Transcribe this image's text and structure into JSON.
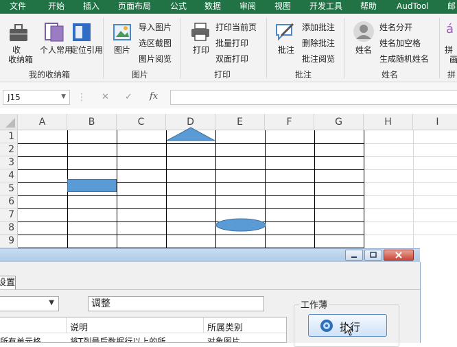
{
  "ribbon_tabs": [
    "文件",
    "开始",
    "插入",
    "页面布局",
    "公式",
    "数据",
    "审阅",
    "视图",
    "开发工具",
    "帮助",
    "AudTool",
    "邮"
  ],
  "groups": {
    "my_storage": {
      "label": "我的收纳箱",
      "storage_box": "收纳箱",
      "personal": "个人常用",
      "locate": "定位引用"
    },
    "picture": {
      "label": "图片",
      "picture": "图片",
      "import": "导入图片",
      "region_capture": "选区截图",
      "browse": "图片阅览"
    },
    "print": {
      "label": "打印",
      "print": "打印",
      "print_page": "打印当前页",
      "batch_print": "批量打印",
      "duplex_print": "双面打印"
    },
    "annotation": {
      "label": "批注",
      "annotate": "批注",
      "add": "添加批注",
      "delete": "删除批注",
      "browse": "批注阅览"
    },
    "name": {
      "label": "姓名",
      "name": "姓名",
      "split": "姓名分开",
      "add_space": "姓名加空格",
      "random": "生成随机姓名"
    },
    "pinyin": {
      "label": "拼",
      "pinyin_partial": "拼",
      "pinyin_partial2": "画"
    }
  },
  "formula_bar": {
    "name_box": "J15",
    "cancel": "✕",
    "confirm": "✓",
    "fx": "fx",
    "content": ""
  },
  "columns": [
    "A",
    "B",
    "C",
    "D",
    "E",
    "F",
    "G",
    "H",
    "I"
  ],
  "rows": [
    "1",
    "2",
    "3",
    "4",
    "5",
    "6",
    "7",
    "8",
    "9"
  ],
  "dialog": {
    "tab_label": "设置",
    "dropdown_value": "",
    "text_field": "调整",
    "group_label": "工作薄",
    "execute_button": "执行",
    "table_headers": [
      "说明",
      "所属类别"
    ],
    "row1": [
      "所有单元格",
      "将T列最后数据行以上的所",
      "对象图片"
    ]
  },
  "colors": {
    "ribbon_green": "#217346",
    "shape_blue": "#5b9bd5",
    "dialog_title": "#b9d1ea"
  }
}
